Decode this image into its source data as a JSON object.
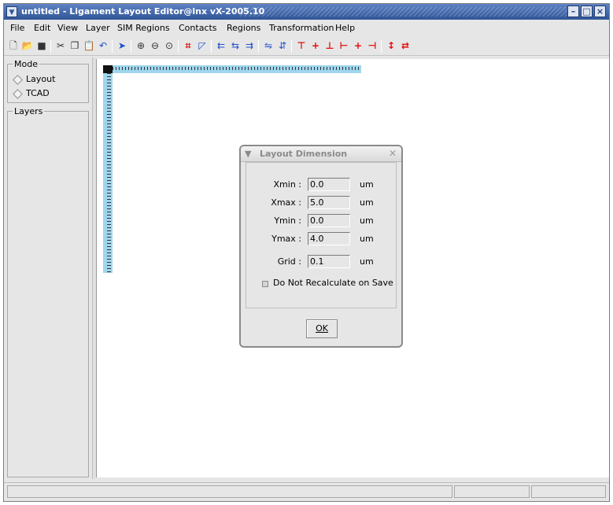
{
  "window": {
    "title": "untitled - Ligament Layout Editor@lnx vX-2005.10",
    "controls": {
      "minimize": "–",
      "maximize": "□",
      "close": "×"
    }
  },
  "menu": [
    "File",
    "Edit",
    "View",
    "Layer",
    "SIM Regions",
    "Contacts",
    "Regions",
    "Transformation",
    "Help"
  ],
  "toolbar": {
    "icons": [
      "new-file-icon",
      "open-folder-icon",
      "save-icon",
      "cut-icon",
      "copy-icon",
      "paste-icon",
      "undo-icon",
      "select-arrow-icon",
      "zoom-in-icon",
      "zoom-out-icon",
      "zoom-fit-icon",
      "rectangle-icon",
      "polygon-icon",
      "align-left-icon",
      "align-center-icon",
      "align-right-icon",
      "flip-horizontal-icon",
      "flip-vertical-icon",
      "align-top-icon",
      "align-vcenter-icon",
      "align-bottom-icon",
      "align-hleft-icon",
      "align-hcenter-icon",
      "align-hright-icon",
      "distribute-vertical-icon",
      "distribute-horizontal-icon"
    ]
  },
  "sidebar": {
    "mode_label": "Mode",
    "mode_options": [
      "Layout",
      "TCAD"
    ],
    "layers_label": "Layers"
  },
  "dialog": {
    "title": "Layout Dimension",
    "fields": [
      {
        "label": "Xmin :",
        "value": "0.0",
        "unit": "um"
      },
      {
        "label": "Xmax :",
        "value": "5.0",
        "unit": "um"
      },
      {
        "label": "Ymin :",
        "value": "0.0",
        "unit": "um"
      },
      {
        "label": "Ymax :",
        "value": "4.0",
        "unit": "um"
      },
      {
        "label": "Grid :",
        "value": "0.1",
        "unit": "um"
      }
    ],
    "checkbox_label": "Do Not Recalculate on Save",
    "ok_label": "OK"
  },
  "colors": {
    "titlebar": "#2f5596",
    "ruler": "#9fd6ef",
    "toolbar_red": "#e01010",
    "toolbar_blue": "#2050c8"
  }
}
